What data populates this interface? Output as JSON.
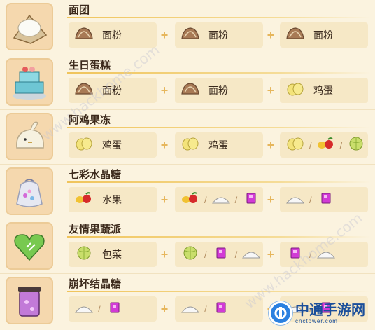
{
  "recipes": [
    {
      "name": "面团",
      "thumb": "dough-icon",
      "slots": [
        {
          "items": [
            "flour-icon"
          ],
          "label": "面粉"
        },
        {
          "items": [
            "flour-icon"
          ],
          "label": "面粉"
        },
        {
          "items": [
            "flour-icon"
          ],
          "label": "面粉"
        }
      ]
    },
    {
      "name": "生日蛋糕",
      "thumb": "birthday-cake-icon",
      "slots": [
        {
          "items": [
            "flour-icon"
          ],
          "label": "面粉"
        },
        {
          "items": [
            "flour-icon"
          ],
          "label": "面粉"
        },
        {
          "items": [
            "egg-icon"
          ],
          "label": "鸡蛋"
        }
      ]
    },
    {
      "name": "阿鸡果冻",
      "thumb": "chick-jelly-icon",
      "slots": [
        {
          "items": [
            "egg-icon"
          ],
          "label": "鸡蛋"
        },
        {
          "items": [
            "egg-icon"
          ],
          "label": "鸡蛋"
        },
        {
          "items": [
            "egg-icon",
            "fruit-icon",
            "cabbage-icon"
          ],
          "label": ""
        }
      ]
    },
    {
      "name": "七彩水晶糖",
      "thumb": "crystal-candy-bag-icon",
      "slots": [
        {
          "items": [
            "fruit-icon"
          ],
          "label": "水果"
        },
        {
          "items": [
            "fruit-icon",
            "sugar-icon",
            "crystal-icon"
          ],
          "label": ""
        },
        {
          "items": [
            "sugar-icon",
            "crystal-icon"
          ],
          "label": ""
        }
      ]
    },
    {
      "name": "友情果蔬派",
      "thumb": "heart-pie-icon",
      "slots": [
        {
          "items": [
            "cabbage-icon"
          ],
          "label": "包菜"
        },
        {
          "items": [
            "cabbage-icon",
            "crystal-icon",
            "sugar-icon"
          ],
          "label": ""
        },
        {
          "items": [
            "crystal-icon",
            "sugar-icon"
          ],
          "label": ""
        }
      ]
    },
    {
      "name": "崩坏结晶糖",
      "thumb": "crystal-jar-icon",
      "slots": [
        {
          "items": [
            "sugar-icon",
            "crystal-icon"
          ],
          "label": ""
        },
        {
          "items": [
            "sugar-icon",
            "crystal-icon"
          ],
          "label": ""
        },
        {
          "items": [
            "sugar-icon",
            "crystal-icon"
          ],
          "label": ""
        }
      ]
    }
  ],
  "plus_symbol": "+",
  "separator": "/",
  "watermark_text": "www.hackhome.com",
  "logo": {
    "title": "中通手游网",
    "subtitle": "cnctower.com",
    "color": "#1a4e9a"
  }
}
